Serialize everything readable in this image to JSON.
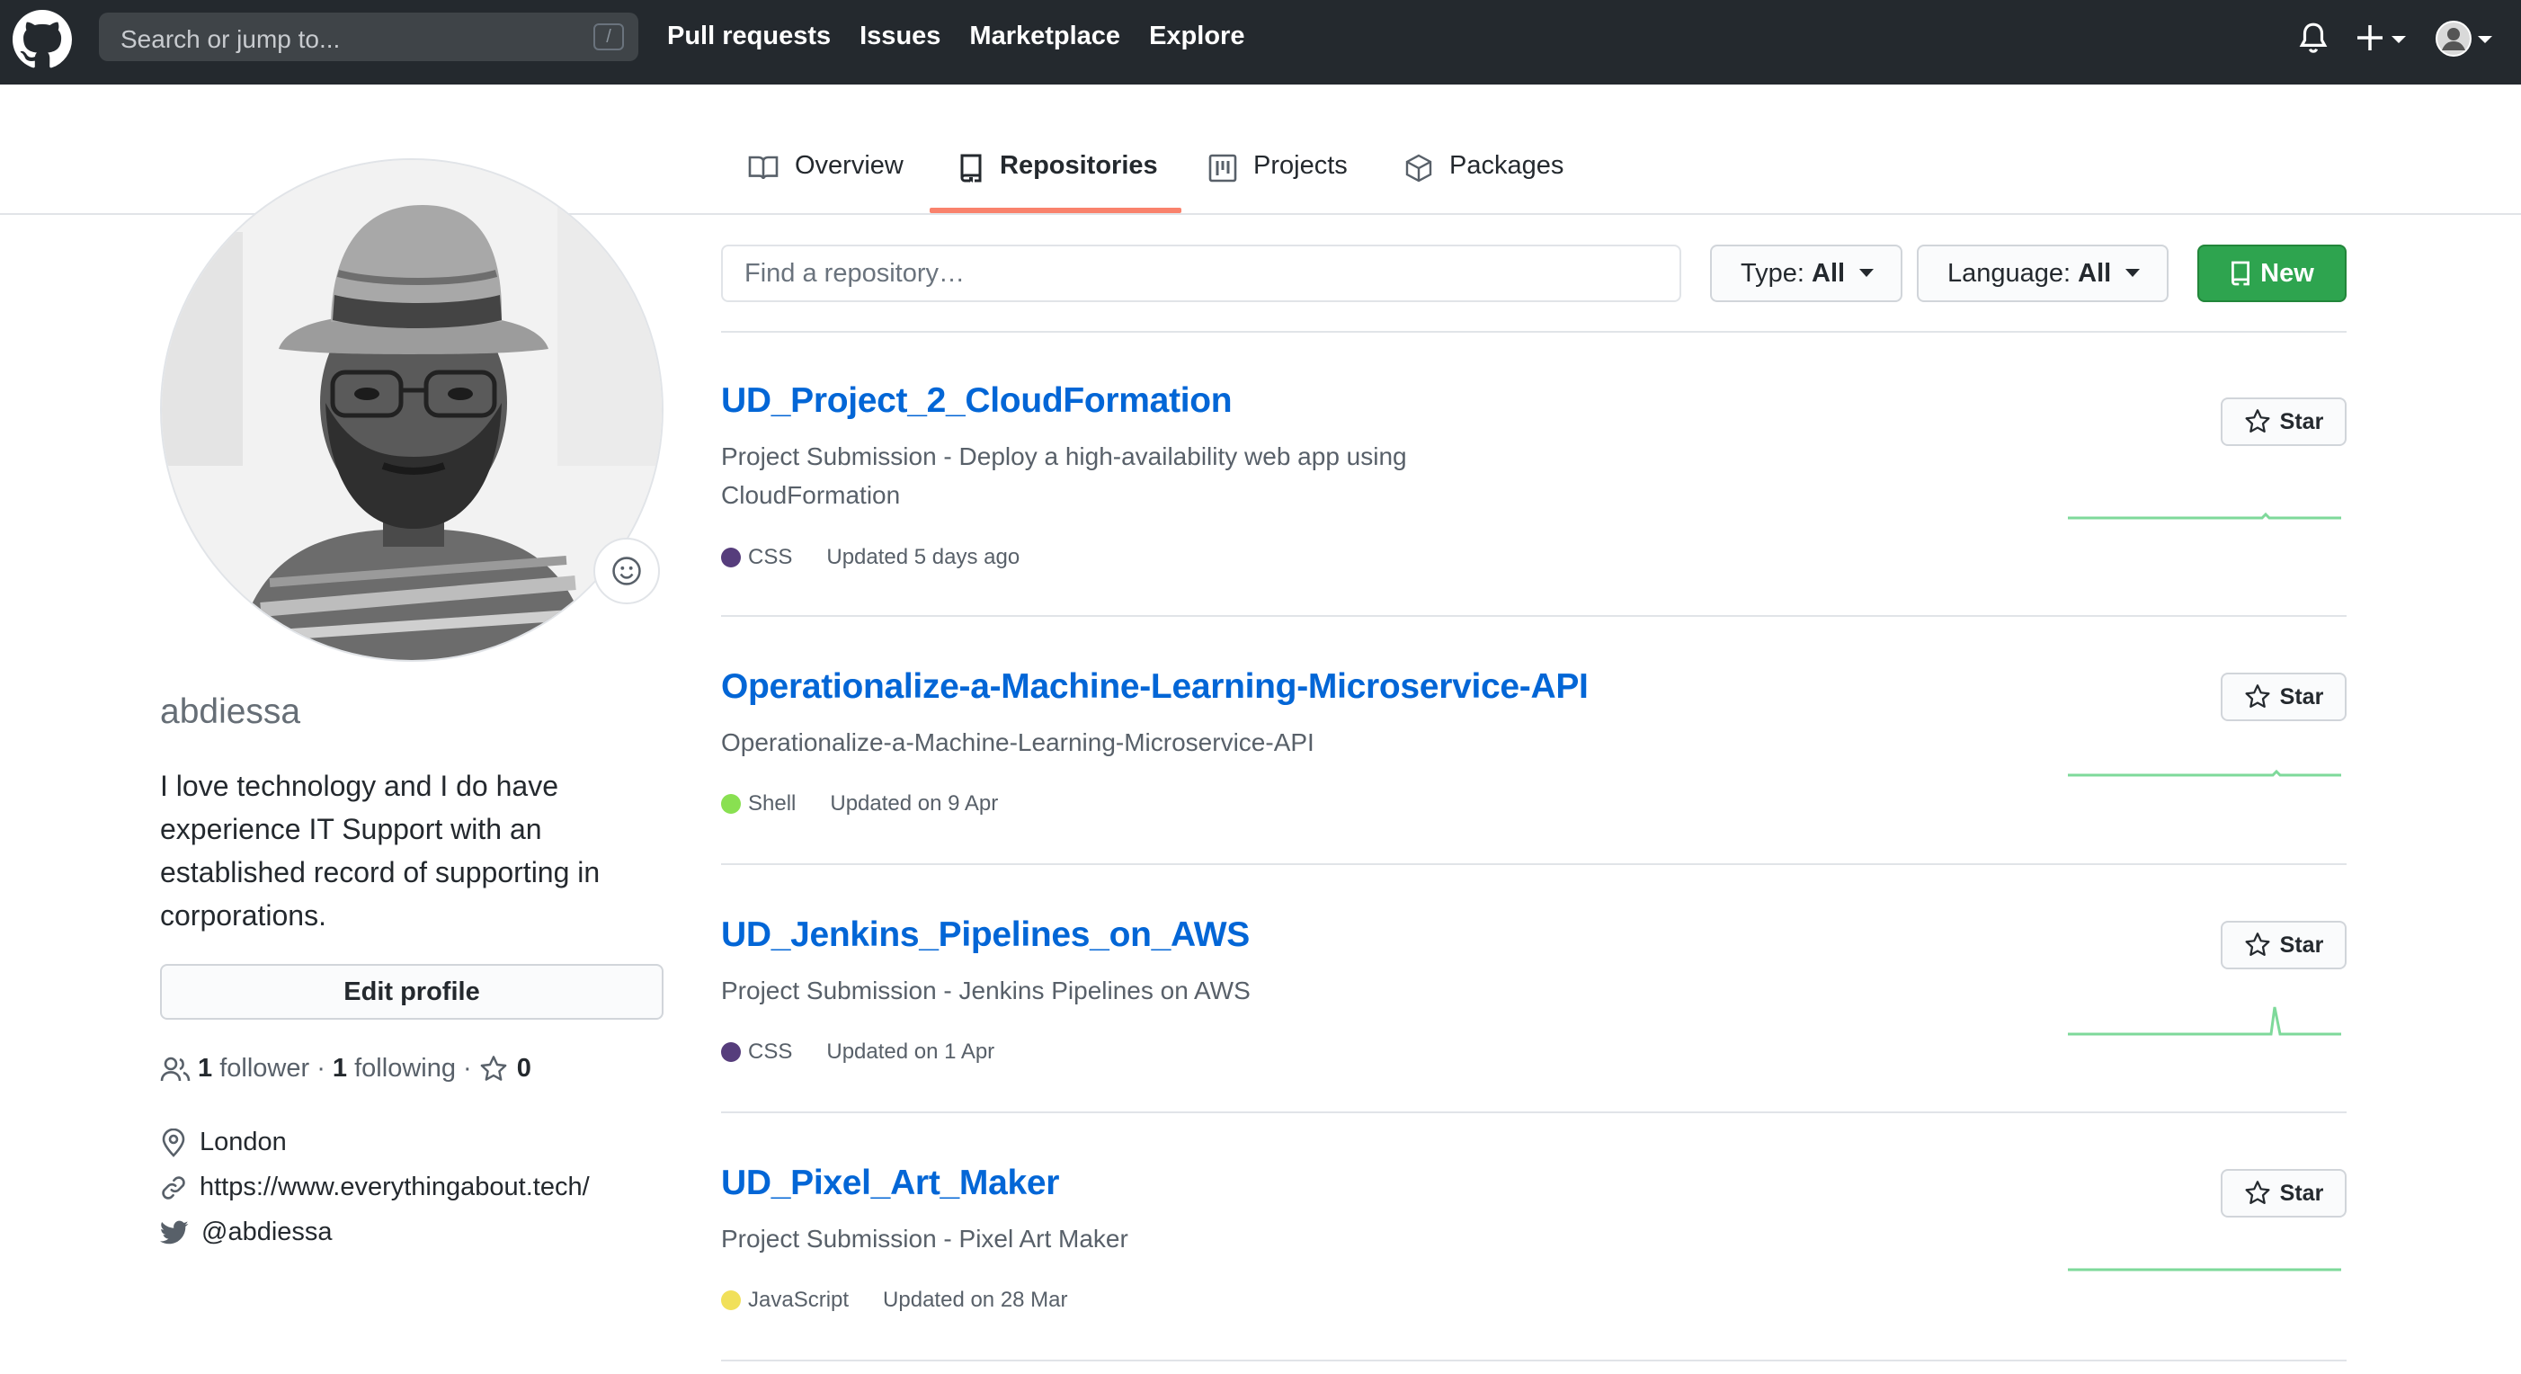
{
  "header": {
    "search_placeholder": "Search or jump to...",
    "search_key": "/",
    "nav": [
      "Pull requests",
      "Issues",
      "Marketplace",
      "Explore"
    ],
    "icons": [
      "github-logo-icon",
      "bell-icon",
      "plus-icon",
      "avatar-icon"
    ]
  },
  "tabs": [
    {
      "label": "Overview",
      "icon": "book-icon",
      "active": false
    },
    {
      "label": "Repositories",
      "icon": "repo-icon",
      "active": true
    },
    {
      "label": "Projects",
      "icon": "project-icon",
      "active": false
    },
    {
      "label": "Packages",
      "icon": "package-icon",
      "active": false
    }
  ],
  "profile": {
    "username": "abdiessa",
    "bio": "I love technology and I do have experience IT Support with an established record of supporting in corporations.",
    "edit_label": "Edit profile",
    "followers_count": "1",
    "followers_label": "follower",
    "following_count": "1",
    "following_label": "following",
    "stars_count": "0",
    "location": "London",
    "website": "https://www.everythingabout.tech/",
    "twitter": "@abdiessa"
  },
  "filters": {
    "find_placeholder": "Find a repository…",
    "type_label": "Type:",
    "type_value": "All",
    "language_label": "Language:",
    "language_value": "All",
    "new_label": "New"
  },
  "colors": {
    "link": "#0366d6",
    "green": "#2ea44f",
    "tab_underline": "#f9826c",
    "header_bg": "#24292e"
  },
  "repos": [
    {
      "name": "UD_Project_2_CloudFormation",
      "description": "Project Submission - Deploy a high-availability web app using CloudFormation",
      "language": "CSS",
      "lang_color": "#563d7c",
      "updated": "Updated 5 days ago",
      "star_label": "Star"
    },
    {
      "name": "Operationalize-a-Machine-Learning-Microservice-API",
      "description": "Operationalize-a-Machine-Learning-Microservice-API",
      "language": "Shell",
      "lang_color": "#89e051",
      "updated": "Updated on 9 Apr",
      "star_label": "Star"
    },
    {
      "name": "UD_Jenkins_Pipelines_on_AWS",
      "description": "Project Submission - Jenkins Pipelines on AWS",
      "language": "CSS",
      "lang_color": "#563d7c",
      "updated": "Updated on 1 Apr",
      "star_label": "Star"
    },
    {
      "name": "UD_Pixel_Art_Maker",
      "description": "Project Submission - Pixel Art Maker",
      "language": "JavaScript",
      "lang_color": "#f1e05a",
      "updated": "Updated on 28 Mar",
      "star_label": "Star"
    }
  ]
}
